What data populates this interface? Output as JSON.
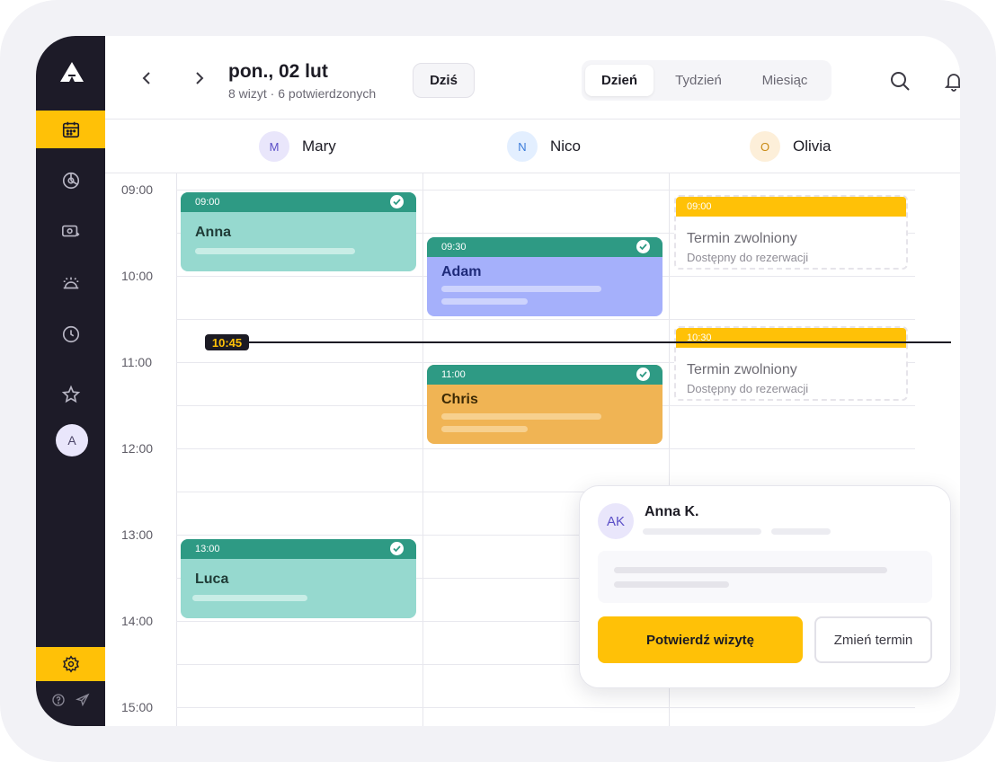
{
  "header": {
    "date_title": "pon., 02 lut",
    "date_subtitle": "8 wizyt · 6 potwierdzonych",
    "today_label": "Dziś",
    "views": [
      "Dzień",
      "Tydzień",
      "Miesiąc"
    ],
    "active_view": "Dzień"
  },
  "sidebar": {
    "items": [
      "calendar-icon",
      "chart-pie-icon",
      "money-icon",
      "service-bell-icon",
      "clock-icon",
      "star-icon"
    ],
    "active_item": "calendar-icon",
    "avatar_initial": "A",
    "settings_icon": "gear-icon",
    "footer_icons": [
      "help-icon",
      "send-icon"
    ]
  },
  "staff": [
    {
      "initial": "M",
      "name": "Mary",
      "color": "#e9e6fb",
      "text_color": "#5b4fc7"
    },
    {
      "initial": "N",
      "name": "Nico",
      "color": "#e3efff",
      "text_color": "#3b7bd9"
    },
    {
      "initial": "O",
      "name": "Olivia",
      "color": "#fdefd9",
      "text_color": "#c98a14"
    }
  ],
  "times": [
    "09:00",
    "10:00",
    "11:00",
    "12:00",
    "13:00",
    "14:00",
    "15:00"
  ],
  "now": "10:45",
  "appointments": [
    {
      "time": "09:00",
      "name": "Anna",
      "color": "#96d9cf",
      "text_color": "#1f3b36"
    },
    {
      "time": "09:30",
      "name": "Adam",
      "color": "#a5b0fb",
      "text_color": "#1f2b7a"
    },
    {
      "time": "11:00",
      "name": "Chris",
      "color": "#f0b454",
      "text_color": "#3d2a05"
    },
    {
      "time": "13:00",
      "name": "Luca",
      "color": "#96d9cf",
      "text_color": "#1f3b36"
    }
  ],
  "free_slots": [
    {
      "time": "09:00",
      "title": "Termin zwolniony",
      "subtitle": "Dostępny do rezerwacji"
    },
    {
      "time": "10:30",
      "title": "Termin zwolniony",
      "subtitle": "Dostępny do rezerwacji"
    }
  ],
  "popup": {
    "initials": "AK",
    "name": "Anna K.",
    "confirm_label": "Potwierdź wizytę",
    "reschedule_label": "Zmień termin"
  },
  "colors": {
    "accent": "#ffc107",
    "sidebar": "#1d1b28",
    "confirmed_bar": "#2e9a84"
  }
}
